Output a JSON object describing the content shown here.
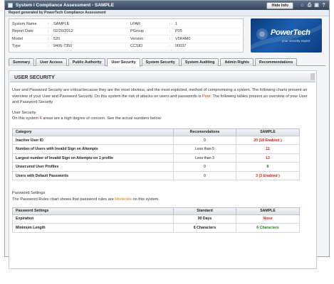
{
  "window": {
    "title": "System i Compliance Assessment - SAMPLE",
    "hide_info_label": "Hide Info",
    "report_by": "Report generated by PowerTech Compliance Assessment"
  },
  "info": {
    "rows": [
      {
        "k": "System Name",
        "v": "SAMPLE",
        "k2": "LPAR",
        "v2": "1"
      },
      {
        "k": "Report Date",
        "v": "02/26/2012",
        "k2": "PGroup",
        "v2": "P05"
      },
      {
        "k": "Model",
        "v": "520",
        "k2": "Version",
        "v2": "V5R4M0"
      },
      {
        "k": "Type",
        "v": "9406-7350",
        "k2": "CCSID",
        "v2": "00037"
      }
    ]
  },
  "logo": {
    "brand": "PowerTech",
    "tagline": "your security expert"
  },
  "tabs": [
    "Summary",
    "User Access",
    "Public Authority",
    "User Security",
    "System Security",
    "System Auditing",
    "Admin Rights",
    "Recommendations"
  ],
  "section": {
    "title": "USER SECURITY",
    "intro_1": "User and Password Security are critical because they are the most obvious, and the most exploited, method of compromising a system.  The following charts present an overview of your User and Password Security.   On this system the risk of attacks on users and passwords is ",
    "intro_risk": "Poor",
    "intro_2": ". The following tables present an overview of your User and Password Security",
    "user_security_heading": "User Security",
    "areas_1": "On this system ",
    "areas_count": "4",
    "areas_2": " areas are a high degree of concern.  See the actual numbers below:",
    "password_heading": "Password Settings",
    "password_1": "The Password Rules chart shows that password rules are ",
    "password_level": "Moderate",
    "password_2": " on this system."
  },
  "user_table": {
    "headers": [
      "Category",
      "Recomendations",
      "SAMPLE"
    ],
    "rows": [
      {
        "cat": "Inactive User ID",
        "rec": "0",
        "val": "20 (18 Enabled )"
      },
      {
        "cat": "Number of Users with Invalid Sign on Attempts",
        "rec": "Less than  5",
        "val": "11"
      },
      {
        "cat": "Largest number of Invalid Sign on Attempts on 1 profile",
        "rec": "Less than  3",
        "val": "13"
      },
      {
        "cat": "Unsecured User Profiles",
        "rec": "0",
        "val": "8"
      },
      {
        "cat": "Users with Default Passwords",
        "rec": "0",
        "val": "3 (3 Enabled )"
      }
    ]
  },
  "password_table": {
    "headers": [
      "Password Settings",
      "Standard",
      "SAMPLE"
    ],
    "rows": [
      {
        "cat": "Expiration",
        "rec": "90 Days",
        "val": "None"
      },
      {
        "cat": "Minimum Length",
        "rec": "6 Characters",
        "val": "6 Characters"
      }
    ]
  },
  "colors": {
    "poor": "#d02020",
    "moderate": "#e07a00",
    "good": "#1a8a1a",
    "titlebar": "#33445a"
  }
}
